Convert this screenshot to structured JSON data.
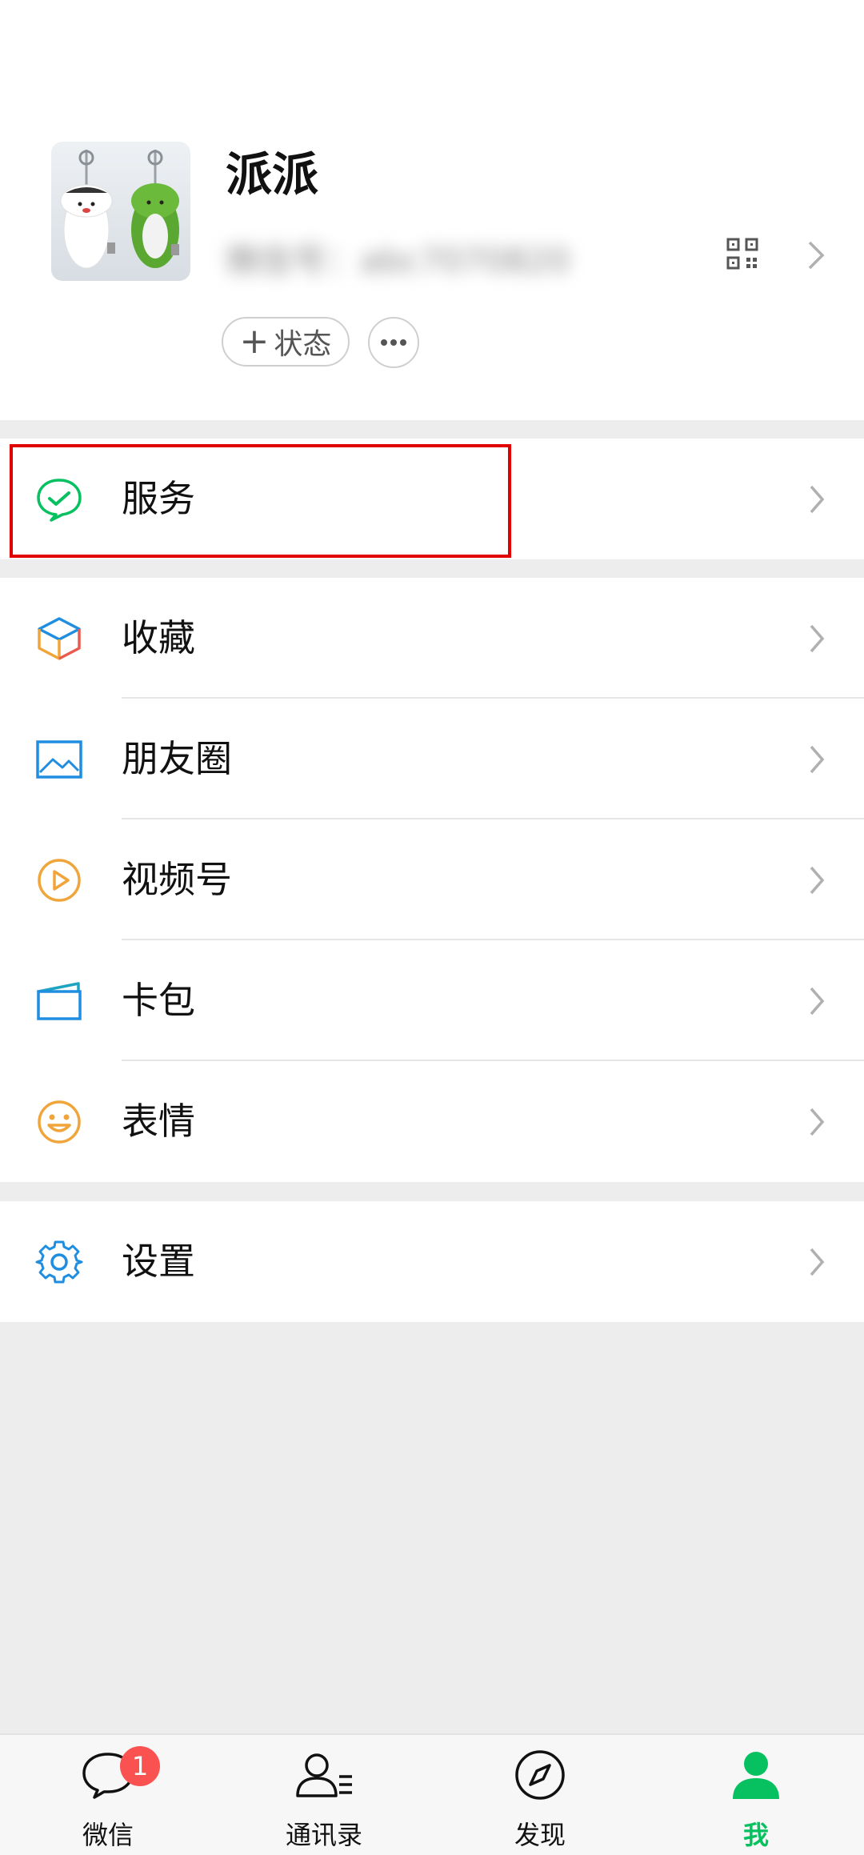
{
  "profile": {
    "nickname": "派派",
    "wechat_id": "微信号：abc7070820",
    "status_label": "状态",
    "status_plus": "+"
  },
  "menu": {
    "services": "服务",
    "favorites": "收藏",
    "moments": "朋友圈",
    "channels": "视频号",
    "cards": "卡包",
    "stickers": "表情",
    "settings": "设置"
  },
  "tabbar": {
    "chats": "微信",
    "contacts": "通讯录",
    "discover": "发现",
    "me": "我",
    "chats_badge": "1"
  },
  "colors": {
    "accent": "#07c160",
    "badge": "#fa5151",
    "highlight": "#e00000"
  }
}
